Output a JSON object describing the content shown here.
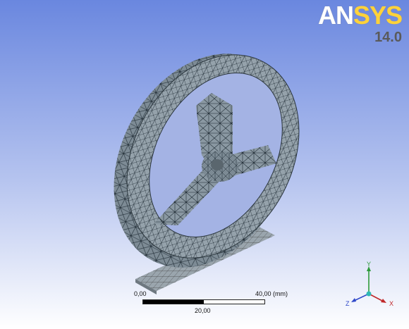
{
  "brand": {
    "logo_text_main": "AN",
    "logo_text_accent": "SYS",
    "version": "14.0"
  },
  "scale": {
    "start_label": "0,00",
    "end_label": "40,00",
    "unit": "(mm)",
    "mid_label": "20,00"
  },
  "triad": {
    "x_label": "X",
    "y_label": "Y",
    "z_label": "Z"
  },
  "colors": {
    "background_top": "#6a87df",
    "background_bottom": "#ffffff",
    "mesh_fill": "#8e9ca6",
    "mesh_lines": "#1e2a33",
    "logo_accent": "#ffd23a",
    "x_axis": "#c0282a",
    "y_axis": "#2e9a3a",
    "z_axis": "#2f48c9"
  }
}
